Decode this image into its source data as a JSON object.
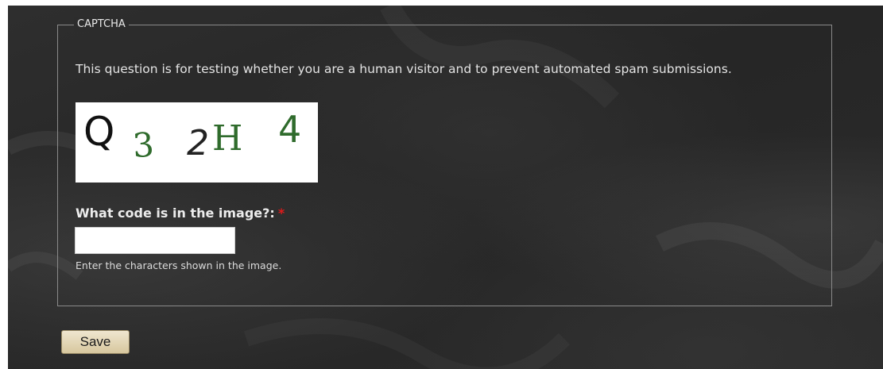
{
  "captcha": {
    "legend": "CAPTCHA",
    "description": "This question is for testing whether you are a human visitor and to prevent automated spam submissions.",
    "image_text": "Q32H4",
    "field_label": "What code is in the image?:",
    "required_marker": "*",
    "input_value": "",
    "help_text": "Enter the characters shown in the image."
  },
  "actions": {
    "save_label": "Save"
  },
  "colors": {
    "background": "#2a2a2a",
    "fieldset_border": "#8a8a8a",
    "text": "#e4e4e4",
    "required": "#e01a1a",
    "button_bg": "#e3d6b3",
    "captcha_green": "#2f6b2c"
  }
}
